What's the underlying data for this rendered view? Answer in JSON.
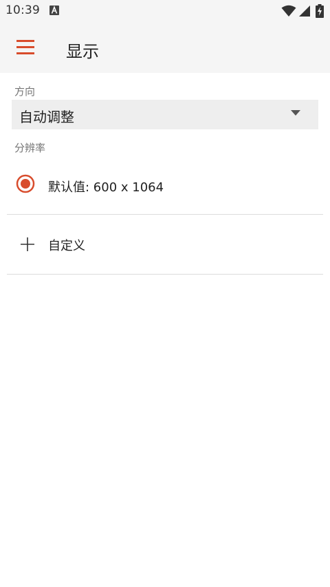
{
  "status_bar": {
    "time": "10:39",
    "icons": [
      "a-notification-icon",
      "wifi-icon",
      "signal-icon",
      "battery-charging-icon"
    ]
  },
  "app_bar": {
    "title": "显示",
    "menu_icon": "hamburger-menu-icon"
  },
  "orientation": {
    "label": "方向",
    "selected_value": "自动调整"
  },
  "resolution": {
    "label": "分辨率",
    "options": [
      {
        "label": "默认值: 600 x 1064",
        "selected": true
      }
    ],
    "custom_label": "自定义"
  },
  "colors": {
    "accent": "#d84c2c",
    "app_bar_bg": "#f5f5f5",
    "select_bg": "#eeeeee",
    "divider": "#dcdcdc"
  }
}
